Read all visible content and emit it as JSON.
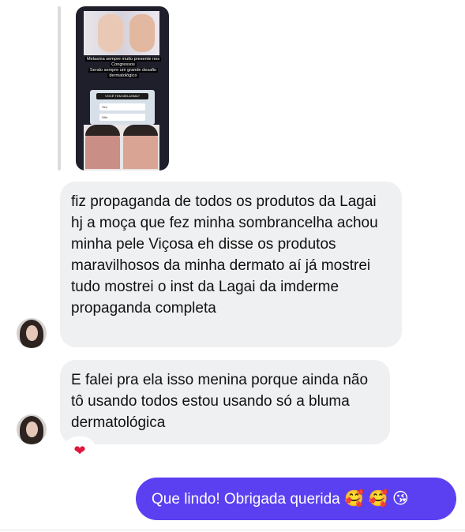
{
  "story_reply": {
    "caption_line1": "Melasma sempre muito presente nos",
    "caption_line2": "Congressos",
    "caption_line3": "Sendo sempre um grande desafio",
    "caption_line4": "dermatológico",
    "poll_question": "VOCÊ TEM MELASMA?",
    "poll_option_1": "Sim",
    "poll_option_2": "Não"
  },
  "messages": [
    {
      "id": "m1",
      "direction": "incoming",
      "text": "fiz propaganda de todos os produtos da Lagai hj a moça que fez minha sombrancelha achou minha pele Viçosa eh disse os produtos maravilhosos da minha dermato aí já mostrei tudo mostrei o inst da Lagai da imderme propaganda completa"
    },
    {
      "id": "m2",
      "direction": "incoming",
      "text": "E falei pra ela isso menina porque ainda não tô usando todos estou usando só a bluma dermatológica",
      "reaction": "❤"
    },
    {
      "id": "m3",
      "direction": "outgoing",
      "text": "Que lindo! Obrigada querida",
      "emojis": "🥰 🥰 😘"
    }
  ],
  "colors": {
    "incoming_bubble": "#eff0f2",
    "outgoing_bubble": "#5b40f2",
    "reaction_heart": "#e0163b"
  }
}
